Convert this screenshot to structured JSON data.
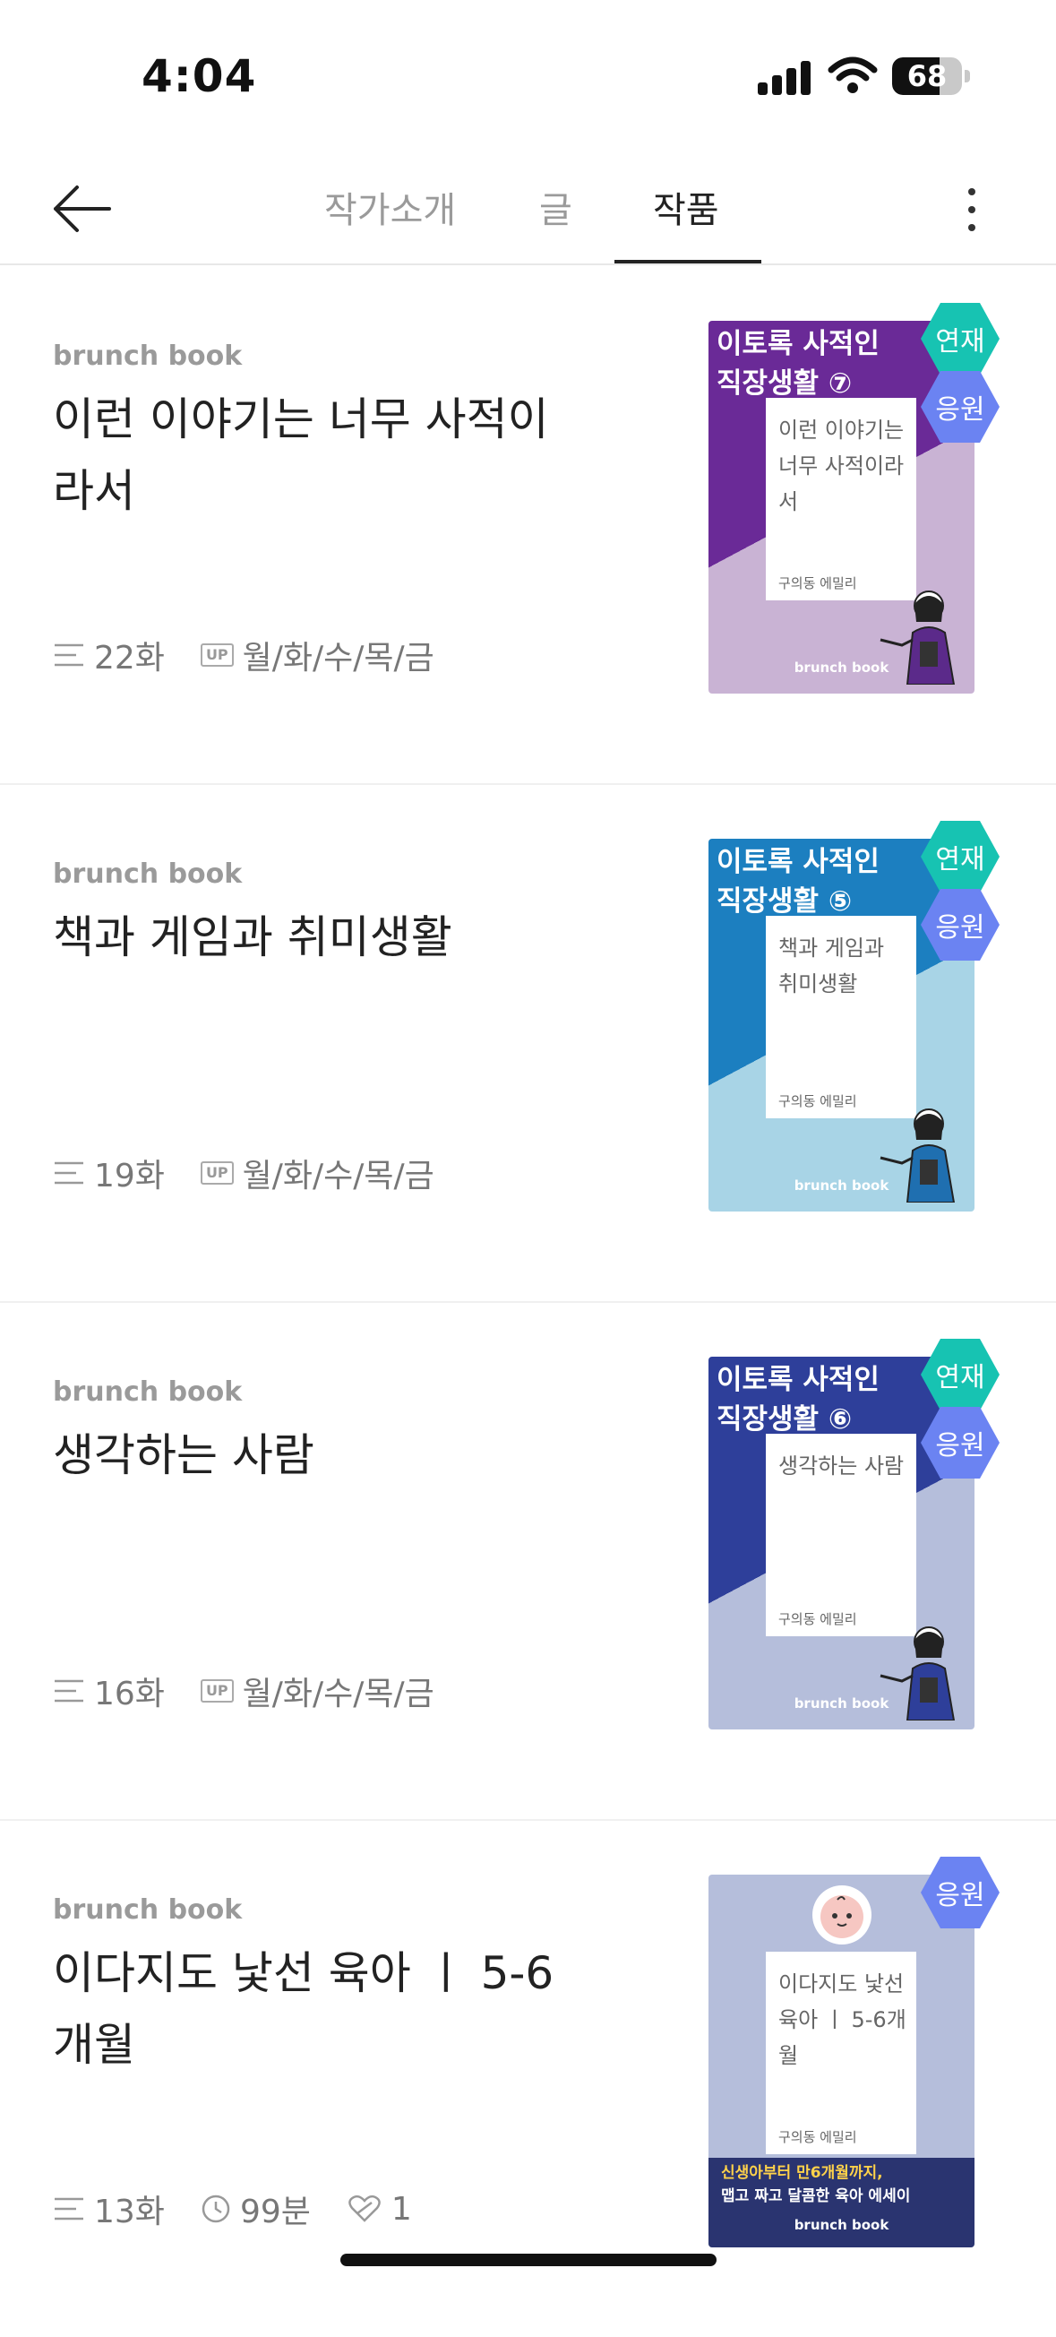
{
  "status_bar": {
    "time": "4:04",
    "battery": "68",
    "battery_level": 0.68
  },
  "nav": {
    "tabs": [
      {
        "label": "작가소개",
        "active": false
      },
      {
        "label": "글",
        "active": false
      },
      {
        "label": "작품",
        "active": true
      }
    ]
  },
  "books": [
    {
      "label": "brunch book",
      "title": "이런 이야기는 너무 사적이라서",
      "episodes": "22화",
      "schedule_badge": "UP",
      "schedule": "월/화/수/목/금",
      "cover": {
        "header_line1": "이토록 사적인",
        "header_line2": "직장생활 ⑦",
        "text": "이런 이야기는 너무 사적이라서",
        "author": "구의동 에밀리",
        "brand": "brunch book",
        "badge_serial": "연재",
        "badge_support": "응원",
        "color_top": "#6a2a97",
        "color_bottom": "#c9b3d4"
      }
    },
    {
      "label": "brunch book",
      "title": "책과 게임과 취미생활",
      "episodes": "19화",
      "schedule_badge": "UP",
      "schedule": "월/화/수/목/금",
      "cover": {
        "header_line1": "이토록 사적인",
        "header_line2": "직장생활 ⑤",
        "text": "책과 게임과 취미생활",
        "author": "구의동 에밀리",
        "brand": "brunch book",
        "badge_serial": "연재",
        "badge_support": "응원",
        "color_top": "#1c7fc0",
        "color_bottom": "#a8d4e6"
      }
    },
    {
      "label": "brunch book",
      "title": "생각하는 사람",
      "episodes": "16화",
      "schedule_badge": "UP",
      "schedule": "월/화/수/목/금",
      "cover": {
        "header_line1": "이토록 사적인",
        "header_line2": "직장생활 ⑥",
        "text": "생각하는 사람",
        "author": "구의동 에밀리",
        "brand": "brunch book",
        "badge_serial": "연재",
        "badge_support": "응원",
        "color_top": "#2e3f9a",
        "color_bottom": "#b5bedb"
      }
    },
    {
      "label": "brunch book",
      "title": "이다지도 낯선 육아 ㅣ 5-6개월",
      "episodes": "13화",
      "duration": "99분",
      "likes": "1",
      "cover": {
        "text": "이다지도 낯선 육아 ㅣ 5-6개월",
        "author": "구의동 에밀리",
        "tagline_line1": "신생아부터 만6개월까지,",
        "tagline_line2": "맵고 짜고 달콤한 육아 에세이",
        "brand": "brunch book",
        "badge_support": "응원",
        "color_top": "#b5bedb",
        "color_bottom": "#2a3470"
      }
    }
  ],
  "colors": {
    "teal_badge": "#17c3b2",
    "blue_badge": "#6b83f2",
    "muted_text": "#9a9a9a"
  }
}
